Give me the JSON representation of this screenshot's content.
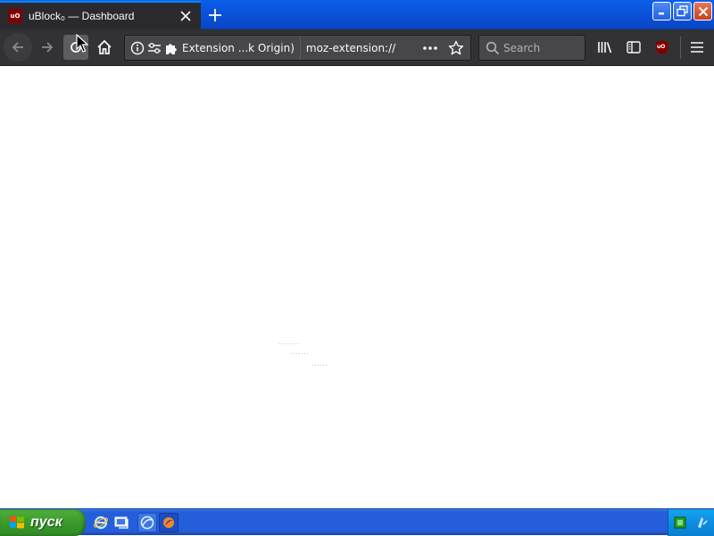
{
  "window": {
    "tab_title": "uBlock₀ — Dashboard",
    "favicon_text": "uO"
  },
  "navbar": {
    "identity_label": "Extension ...k Origin)",
    "url_value": "moz-extension://",
    "search_placeholder": "Search",
    "ublock_badge": "uO"
  },
  "taskbar": {
    "start_label": "пуск"
  },
  "colors": {
    "toolbar": "#323234",
    "tab_active": "#2a2a2e",
    "xp_blue": "#245edb",
    "start_green": "#3a9a2b",
    "ublock_red": "#800000"
  }
}
